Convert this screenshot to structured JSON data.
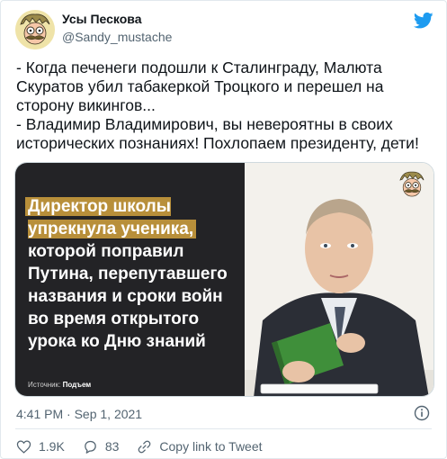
{
  "header": {
    "display_name": "Усы Пескова",
    "handle": "@Sandy_mustache",
    "avatar_icon": "mustache-cartoon-avatar-icon",
    "logo_icon": "twitter-bird-icon"
  },
  "tweet": {
    "text": "- Когда печенеги подошли к Сталинграду, Малюта Скуратов убил табакеркой Троцкого и перешел на сторону викингов...\n- Владимир Владимирович, вы невероятны в своих исторических познаниях! Похлопаем президенту, дети!"
  },
  "media": {
    "headline_highlight": "Директор школы упрекнула ученика,",
    "headline_rest": "которой поправил Путина, перепутавшего названия и сроки войн во время открытого урока ко Дню знаний",
    "source_label": "Источник:",
    "source_name": "Подъем",
    "accent_color": "#b88f3a"
  },
  "meta": {
    "timestamp": "4:41 PM · Sep 1, 2021",
    "info_icon": "info-icon"
  },
  "actions": {
    "like_count": "1.9K",
    "reply_count": "83",
    "copy_link_label": "Copy link to Tweet"
  }
}
